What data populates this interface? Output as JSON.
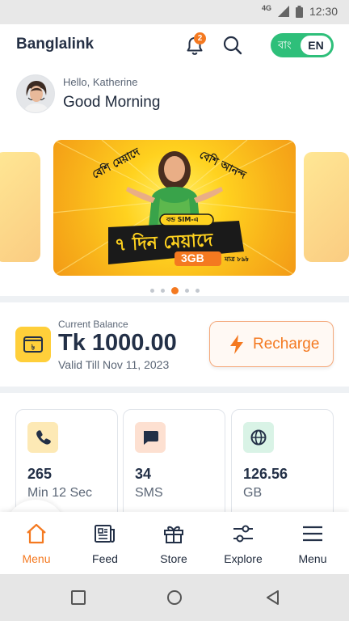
{
  "status_bar": {
    "network": "4G",
    "time": "12:30"
  },
  "header": {
    "app_title": "Banglalink",
    "notification_count": "2",
    "language": {
      "bangla": "বাং",
      "english": "EN",
      "selected": "EN"
    },
    "greeting": "Hello, Katherine",
    "salutation": "Good Morning"
  },
  "banner": {
    "carousel": {
      "total_slides": 5,
      "active_index": 2
    },
    "slide_text": {
      "tagline_left": "বেশি মেয়াদে",
      "tagline_right": "বেশি আনন্দ",
      "pill": "বন্ড SIM-এ",
      "headline": "৭ দিন মেয়াদে",
      "data_pack": "3GB",
      "price": "মাত্র ৮৯৳"
    }
  },
  "balance": {
    "label": "Current Balance",
    "amount": "Tk 1000.00",
    "validity": "Valid Till Nov 11, 2023",
    "recharge_label": "Recharge"
  },
  "usage": [
    {
      "icon": "phone-icon",
      "value": "265",
      "unit": "Min 12 Sec",
      "icon_bg": "#fde9b5",
      "icon_color": "#233047"
    },
    {
      "icon": "sms-icon",
      "value": "34",
      "unit": "SMS",
      "icon_bg": "#fde0d1",
      "icon_color": "#233047"
    },
    {
      "icon": "globe-icon",
      "value": "126.56",
      "unit": "GB",
      "icon_bg": "#d9f3e6",
      "icon_color": "#233047"
    }
  ],
  "bottom_nav": [
    {
      "label": "Menu",
      "icon": "home-icon",
      "active": true
    },
    {
      "label": "Feed",
      "icon": "feed-icon",
      "active": false
    },
    {
      "label": "Store",
      "icon": "store-icon",
      "active": false
    },
    {
      "label": "Explore",
      "icon": "explore-icon",
      "active": false
    },
    {
      "label": "Menu",
      "icon": "hamburger-icon",
      "active": false
    }
  ],
  "colors": {
    "accent": "#f47920",
    "toggle": "#2ebf7a",
    "wallet": "#ffcf3a",
    "banner": "#ffd21f"
  }
}
